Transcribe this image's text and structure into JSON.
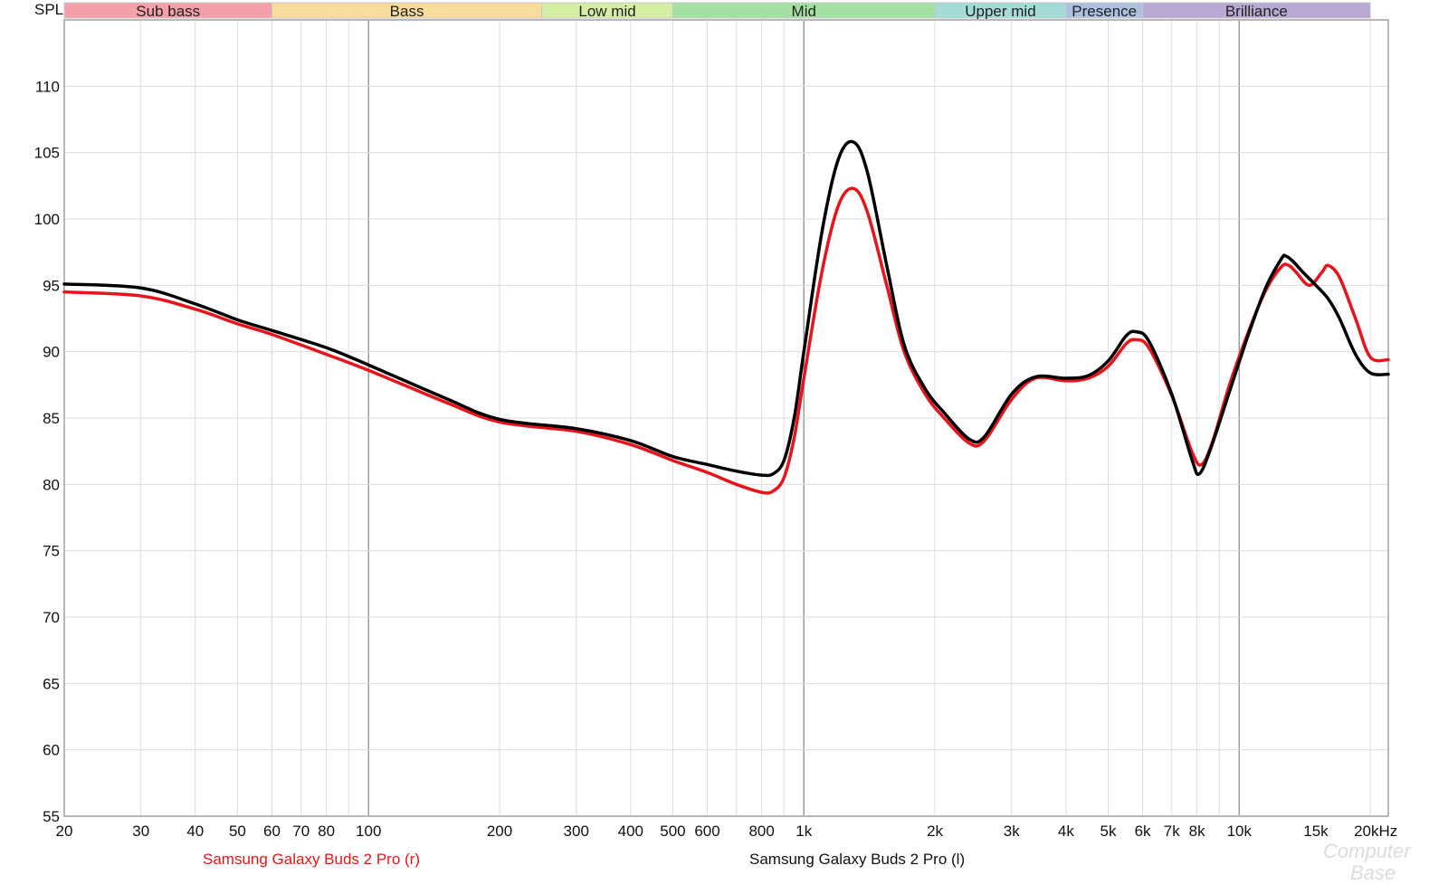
{
  "chart_data": {
    "type": "line",
    "ylabel": "SPL",
    "x_scale": "log",
    "xlim": [
      20,
      22000
    ],
    "ylim": [
      55,
      115
    ],
    "grid": true,
    "y_ticks": [
      {
        "value": 55,
        "label": "55"
      },
      {
        "value": 60,
        "label": "60"
      },
      {
        "value": 65,
        "label": "65"
      },
      {
        "value": 70,
        "label": "70"
      },
      {
        "value": 75,
        "label": "75"
      },
      {
        "value": 80,
        "label": "80"
      },
      {
        "value": 85,
        "label": "85"
      },
      {
        "value": 90,
        "label": "90"
      },
      {
        "value": 95,
        "label": "95"
      },
      {
        "value": 100,
        "label": "100"
      },
      {
        "value": 105,
        "label": "105"
      },
      {
        "value": 110,
        "label": "110"
      }
    ],
    "x_ticks": [
      {
        "value": 20,
        "label": "20"
      },
      {
        "value": 30,
        "label": "30"
      },
      {
        "value": 40,
        "label": "40"
      },
      {
        "value": 50,
        "label": "50"
      },
      {
        "value": 60,
        "label": "60"
      },
      {
        "value": 70,
        "label": "70"
      },
      {
        "value": 80,
        "label": "80"
      },
      {
        "value": 100,
        "label": "100"
      },
      {
        "value": 200,
        "label": "200"
      },
      {
        "value": 300,
        "label": "300"
      },
      {
        "value": 400,
        "label": "400"
      },
      {
        "value": 500,
        "label": "500"
      },
      {
        "value": 600,
        "label": "600"
      },
      {
        "value": 800,
        "label": "800"
      },
      {
        "value": 1000,
        "label": "1k"
      },
      {
        "value": 2000,
        "label": "2k"
      },
      {
        "value": 3000,
        "label": "3k"
      },
      {
        "value": 4000,
        "label": "4k"
      },
      {
        "value": 5000,
        "label": "5k"
      },
      {
        "value": 6000,
        "label": "6k"
      },
      {
        "value": 7000,
        "label": "7k"
      },
      {
        "value": 8000,
        "label": "8k"
      },
      {
        "value": 10000,
        "label": "10k"
      },
      {
        "value": 15000,
        "label": "15k"
      },
      {
        "value": 20000,
        "label": "20kHz"
      }
    ],
    "bands": [
      {
        "name": "Sub bass",
        "from": 20,
        "to": 60,
        "color": "#f4a0a8"
      },
      {
        "name": "Bass",
        "from": 60,
        "to": 250,
        "color": "#f8dc9c"
      },
      {
        "name": "Low mid",
        "from": 250,
        "to": 500,
        "color": "#d4eea4"
      },
      {
        "name": "Mid",
        "from": 500,
        "to": 2000,
        "color": "#a4e0a4"
      },
      {
        "name": "Upper mid",
        "from": 2000,
        "to": 4000,
        "color": "#a4dcd8"
      },
      {
        "name": "Presence",
        "from": 4000,
        "to": 6000,
        "color": "#acc0e0"
      },
      {
        "name": "Brilliance",
        "from": 6000,
        "to": 20000,
        "color": "#b8a8d4"
      }
    ],
    "series": [
      {
        "name": "Samsung Galaxy Buds 2 Pro (r)",
        "color": "#e8141c",
        "points": [
          [
            20,
            94.5
          ],
          [
            30,
            94.2
          ],
          [
            40,
            93.2
          ],
          [
            50,
            92.1
          ],
          [
            60,
            91.3
          ],
          [
            80,
            89.8
          ],
          [
            100,
            88.6
          ],
          [
            150,
            86.2
          ],
          [
            200,
            84.7
          ],
          [
            300,
            84.0
          ],
          [
            400,
            83.0
          ],
          [
            500,
            81.8
          ],
          [
            600,
            80.9
          ],
          [
            700,
            80.0
          ],
          [
            800,
            79.4
          ],
          [
            850,
            79.5
          ],
          [
            900,
            80.5
          ],
          [
            950,
            83.5
          ],
          [
            1000,
            88.0
          ],
          [
            1100,
            96.0
          ],
          [
            1200,
            101.0
          ],
          [
            1300,
            102.3
          ],
          [
            1400,
            100.5
          ],
          [
            1550,
            95.0
          ],
          [
            1700,
            90.0
          ],
          [
            1900,
            86.8
          ],
          [
            2100,
            85.0
          ],
          [
            2400,
            83.1
          ],
          [
            2600,
            83.3
          ],
          [
            3000,
            86.4
          ],
          [
            3400,
            88.0
          ],
          [
            4000,
            87.8
          ],
          [
            4500,
            88.0
          ],
          [
            5000,
            88.9
          ],
          [
            5500,
            90.6
          ],
          [
            5800,
            90.9
          ],
          [
            6200,
            90.3
          ],
          [
            7000,
            86.7
          ],
          [
            7800,
            82.4
          ],
          [
            8200,
            81.5
          ],
          [
            8700,
            83.3
          ],
          [
            9500,
            87.5
          ],
          [
            10500,
            91.5
          ],
          [
            11500,
            94.6
          ],
          [
            12500,
            96.4
          ],
          [
            13000,
            96.5
          ],
          [
            13500,
            96.0
          ],
          [
            14500,
            95.0
          ],
          [
            15500,
            96.0
          ],
          [
            16000,
            96.5
          ],
          [
            17000,
            95.6
          ],
          [
            18500,
            92.5
          ],
          [
            20000,
            89.6
          ],
          [
            22000,
            89.4
          ]
        ]
      },
      {
        "name": "Samsung Galaxy Buds 2 Pro (l)",
        "color": "#000000",
        "points": [
          [
            20,
            95.1
          ],
          [
            30,
            94.8
          ],
          [
            40,
            93.6
          ],
          [
            50,
            92.4
          ],
          [
            60,
            91.6
          ],
          [
            80,
            90.3
          ],
          [
            100,
            89.0
          ],
          [
            150,
            86.5
          ],
          [
            200,
            84.9
          ],
          [
            300,
            84.2
          ],
          [
            400,
            83.3
          ],
          [
            500,
            82.1
          ],
          [
            600,
            81.5
          ],
          [
            700,
            81.0
          ],
          [
            800,
            80.7
          ],
          [
            850,
            80.8
          ],
          [
            900,
            81.8
          ],
          [
            950,
            85.0
          ],
          [
            1000,
            90.0
          ],
          [
            1100,
            99.0
          ],
          [
            1200,
            104.5
          ],
          [
            1300,
            105.8
          ],
          [
            1400,
            103.5
          ],
          [
            1550,
            96.5
          ],
          [
            1700,
            90.5
          ],
          [
            1900,
            87.2
          ],
          [
            2100,
            85.4
          ],
          [
            2400,
            83.4
          ],
          [
            2600,
            83.6
          ],
          [
            3000,
            86.8
          ],
          [
            3400,
            88.1
          ],
          [
            4000,
            88.0
          ],
          [
            4500,
            88.2
          ],
          [
            5000,
            89.3
          ],
          [
            5500,
            91.2
          ],
          [
            5800,
            91.5
          ],
          [
            6200,
            90.8
          ],
          [
            7000,
            86.8
          ],
          [
            7800,
            81.8
          ],
          [
            8100,
            80.8
          ],
          [
            8600,
            82.7
          ],
          [
            9500,
            87.0
          ],
          [
            10500,
            91.3
          ],
          [
            11500,
            94.8
          ],
          [
            12500,
            97.0
          ],
          [
            12800,
            97.2
          ],
          [
            13300,
            96.8
          ],
          [
            14000,
            96.0
          ],
          [
            15000,
            95.0
          ],
          [
            16000,
            94.0
          ],
          [
            17000,
            92.5
          ],
          [
            18500,
            89.8
          ],
          [
            20000,
            88.4
          ],
          [
            22000,
            88.3
          ]
        ]
      }
    ]
  },
  "legend": {
    "right": "Samsung Galaxy Buds 2 Pro (r)",
    "left": "Samsung Galaxy Buds 2 Pro (l)"
  },
  "watermark": "ComputerBase"
}
